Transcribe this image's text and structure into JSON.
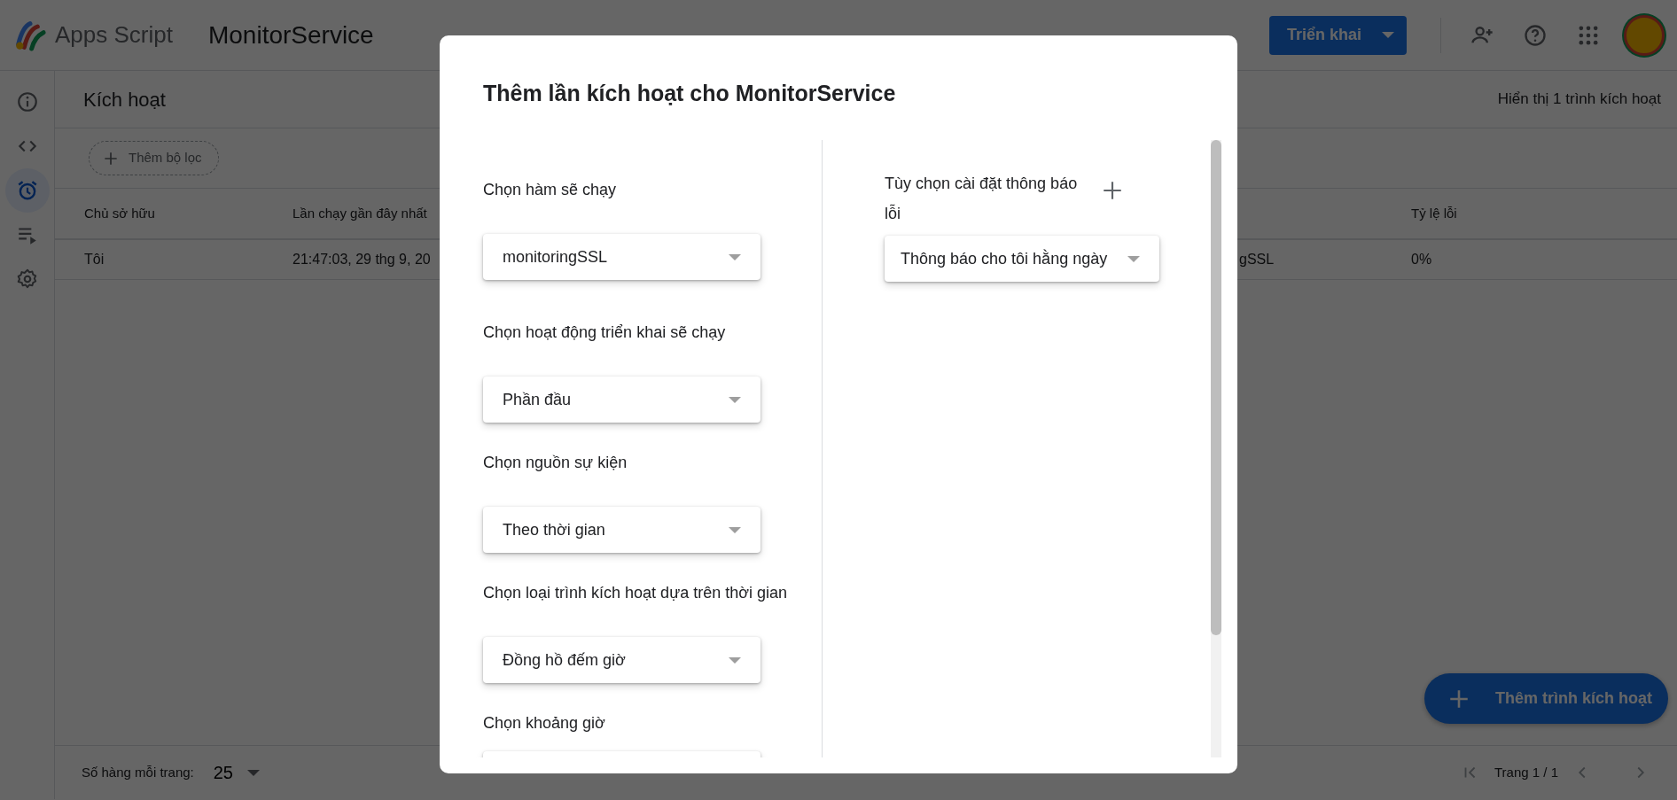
{
  "app": {
    "name": "Apps Script",
    "project": "MonitorService",
    "deploy_button": "Triển khai"
  },
  "rail": [
    {
      "kind": "info",
      "selected": false
    },
    {
      "kind": "code",
      "selected": false
    },
    {
      "kind": "clock",
      "selected": true
    },
    {
      "kind": "executions",
      "selected": false
    },
    {
      "kind": "settings",
      "selected": false
    }
  ],
  "page": {
    "title": "Kích hoạt",
    "count": "Hiển thị 1 trình kích hoạt",
    "filter_chip": "Thêm bộ lọc"
  },
  "table": {
    "columns": {
      "owner": "Chủ sở hữu",
      "last_run": "Lần chạy gần đây nhất",
      "error_rate": "Tỷ lệ lỗi"
    },
    "rows": [
      {
        "owner": "Tôi",
        "last_run": "21:47:03, 29 thg 9, 20",
        "column_3": "gSSL",
        "error_rate": "0%"
      }
    ]
  },
  "pagination": {
    "rows_label": "Số hàng mỗi trang:",
    "rows_value": "25",
    "page": "Trang 1 / 1"
  },
  "fab": "Thêm trình kích hoạt",
  "dialog": {
    "title": "Thêm lần kích hoạt cho MonitorService",
    "fields": [
      {
        "label": "Chọn hàm sẽ chạy",
        "value": "monitoringSSL"
      },
      {
        "label": "Chọn hoạt động triển khai sẽ chạy",
        "value": "Phần đầu"
      },
      {
        "label": "Chọn nguồn sự kiện",
        "value": "Theo thời gian"
      },
      {
        "label": "Chọn loại trình kích hoạt dựa trên thời gian",
        "value": "Đồng hồ đếm giờ"
      },
      {
        "label": "Chọn khoảng giờ"
      }
    ],
    "notification": {
      "label": "Tùy chọn cài đặt thông báo lỗi",
      "value": "Thông báo cho tôi hằng ngày"
    }
  }
}
